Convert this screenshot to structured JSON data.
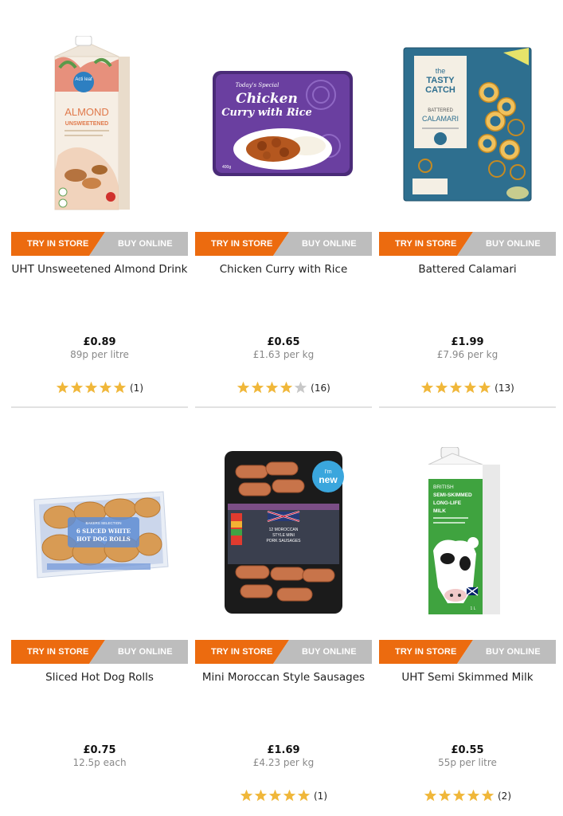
{
  "colors": {
    "store": "#ec6b0f",
    "online": "#bdbdbd",
    "star_on": "#f0b73a",
    "star_off": "#c8c8c8"
  },
  "products": [
    {
      "name": "UHT Unsweetened Almond Drink",
      "price": "£0.89",
      "unit": "89p per litre",
      "rating": 5,
      "count": "(1)",
      "image": "almond-milk-carton",
      "cta_store": "TRY IN STORE",
      "cta_online": "BUY ONLINE"
    },
    {
      "name": "Chicken Curry with Rice",
      "price": "£0.65",
      "unit": "£1.63 per kg",
      "rating": 4,
      "count": "(16)",
      "image": "curry-ready-meal",
      "cta_store": "TRY IN STORE",
      "cta_online": "BUY ONLINE"
    },
    {
      "name": "Battered Calamari",
      "price": "£1.99",
      "unit": "£7.96 per kg",
      "rating": 5,
      "count": "(13)",
      "image": "calamari-bag",
      "cta_store": "TRY IN STORE",
      "cta_online": "BUY ONLINE"
    },
    {
      "name": "Sliced Hot Dog Rolls",
      "price": "£0.75",
      "unit": "12.5p each",
      "rating": 0,
      "count": "",
      "image": "hot-dog-rolls-bag",
      "cta_store": "TRY IN STORE",
      "cta_online": "BUY ONLINE"
    },
    {
      "name": "Mini Moroccan Style Sausages",
      "price": "£1.69",
      "unit": "£4.23 per kg",
      "rating": 5,
      "count": "(1)",
      "image": "sausage-tray",
      "cta_store": "TRY IN STORE",
      "cta_online": "BUY ONLINE"
    },
    {
      "name": "UHT Semi Skimmed Milk",
      "price": "£0.55",
      "unit": "55p per litre",
      "rating": 5,
      "count": "(2)",
      "image": "semi-skimmed-milk-carton",
      "cta_store": "TRY IN STORE",
      "cta_online": "BUY ONLINE"
    }
  ],
  "packaging": {
    "almond": {
      "brand": "Acti leaf",
      "title": "ALMOND",
      "sub": "UNSWEETENED"
    },
    "curry": {
      "brand": "Today's Special",
      "title1": "Chicken",
      "title2": "Curry with Rice",
      "weight": "400g"
    },
    "calamari": {
      "brand1": "the",
      "brand2": "TASTY",
      "brand3": "CATCH",
      "sub": "BATTERED",
      "title": "CALAMARI"
    },
    "rolls": {
      "brand": "BAKERS SELECTION",
      "line1": "6 SLICED WHITE",
      "line2": "HOT DOG ROLLS"
    },
    "sausages": {
      "badge1": "I'm",
      "badge2": "new",
      "line1": "12 MOROCCAN",
      "line2": "STYLE MINI",
      "line3": "PORK SAUSAGES"
    },
    "milk": {
      "line1": "BRITISH",
      "line2": "SEMI-SKIMMED",
      "line3": "LONG-LIFE",
      "line4": "MILK",
      "vol": "1 L"
    }
  }
}
